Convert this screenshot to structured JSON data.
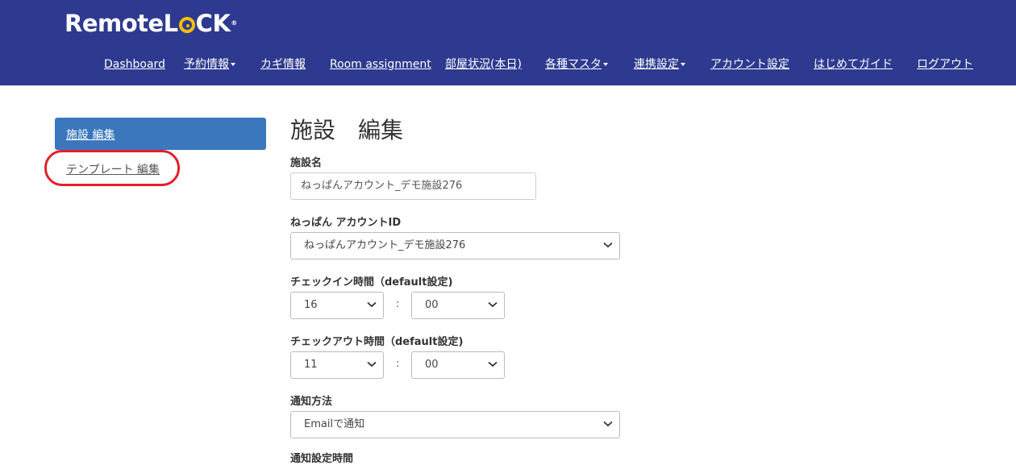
{
  "brand": {
    "logo_text_1": "Remote",
    "logo_text_2": "L",
    "logo_text_3": "CK",
    "logo_tm": "®"
  },
  "nav": {
    "items": [
      {
        "label": "Dashboard"
      },
      {
        "label": "予約情報"
      },
      {
        "label": "カギ情報"
      },
      {
        "label": "Room assignment"
      },
      {
        "label": "部屋状況(本日)"
      },
      {
        "label": "各種マスタ"
      },
      {
        "label": "連携設定"
      },
      {
        "label": "アカウント設定"
      },
      {
        "label": "はじめてガイド"
      },
      {
        "label": "ログアウト"
      }
    ]
  },
  "sidebar": {
    "items": [
      {
        "label": "施設 編集",
        "active": true
      },
      {
        "label": "テンプレート 編集",
        "active": false
      }
    ],
    "annotation_color": "#e0202a"
  },
  "main": {
    "title": "施設　編集",
    "facility_name": {
      "label": "施設名",
      "value": "ねっぱんアカウント_デモ施設276"
    },
    "neppan_account": {
      "label": "ねっぱん アカウントID",
      "value": "ねっぱんアカウント_デモ施設276"
    },
    "checkin": {
      "label": "チェックイン時間（default設定)",
      "hour": "16",
      "minute": "00",
      "separator": ":"
    },
    "checkout": {
      "label": "チェックアウト時間（default設定)",
      "hour": "11",
      "minute": "00",
      "separator": ":"
    },
    "notify": {
      "label": "通知方法",
      "value": "Emailで通知"
    },
    "next_label_cut": "通知設定時間"
  },
  "colors": {
    "header_bg": "#2e3a8f",
    "active_bg": "#3a77bd",
    "logo_accent": "#f5c000"
  }
}
